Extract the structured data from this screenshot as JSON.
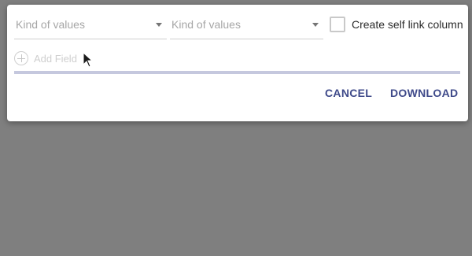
{
  "dialog": {
    "select_1": {
      "value": "Kind of values",
      "icon": "chevron-down-icon"
    },
    "select_2": {
      "value": "Kind of values",
      "icon": "chevron-down-icon"
    },
    "self_link_checkbox": {
      "label": "Create self link column",
      "checked": false
    },
    "add_field": {
      "label": "Add Field",
      "icon": "add-circle-icon"
    },
    "progress": {
      "value": 1.0,
      "color": "#c5c8de"
    },
    "actions": {
      "cancel_label": "CANCEL",
      "download_label": "DOWNLOAD"
    }
  },
  "colors": {
    "backdrop": "#7f7f7f",
    "accent": "#3f4a8a"
  }
}
